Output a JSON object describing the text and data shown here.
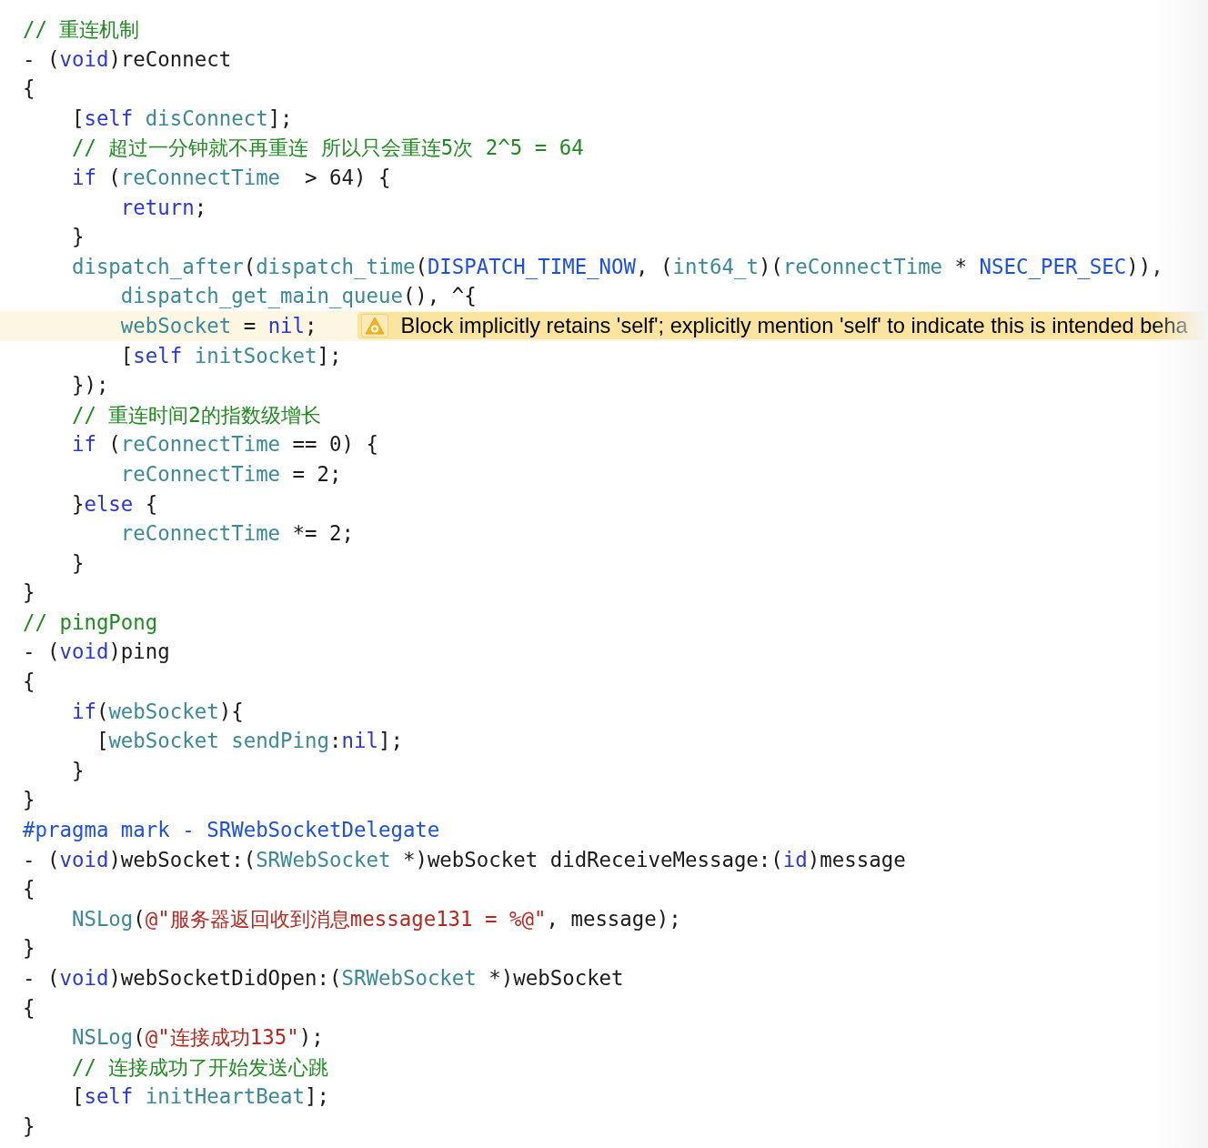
{
  "lines": [
    {
      "tokens": [
        {
          "comment": "// 重连机制"
        }
      ]
    },
    {
      "tokens": [
        {
          "plain": "- ("
        },
        {
          "keyword": "void"
        },
        {
          "plain": ")reConnect"
        }
      ]
    },
    {
      "tokens": [
        {
          "plain": "{"
        }
      ]
    },
    {
      "tokens": [
        {
          "plain": "    ["
        },
        {
          "keyword": "self"
        },
        {
          "ident": " disConnect"
        },
        {
          "plain": "];"
        }
      ]
    },
    {
      "tokens": [
        {
          "comment": "    // 超过一分钟就不再重连 所以只会重连5次 2^5 = 64"
        }
      ]
    },
    {
      "tokens": [
        {
          "keyword": "    if"
        },
        {
          "plain": " ("
        },
        {
          "ident": "reConnectTime"
        },
        {
          "plain": "  > 64) {"
        }
      ]
    },
    {
      "tokens": [
        {
          "keyword": "        return"
        },
        {
          "plain": ";"
        }
      ]
    },
    {
      "tokens": [
        {
          "plain": "    }"
        }
      ]
    },
    {
      "tokens": [
        {
          "ident": "    dispatch_after"
        },
        {
          "plain": "("
        },
        {
          "ident": "dispatch_time"
        },
        {
          "plain": "("
        },
        {
          "macro": "DISPATCH_TIME_NOW"
        },
        {
          "plain": ", ("
        },
        {
          "ident": "int64_t"
        },
        {
          "plain": ")("
        },
        {
          "ident": "reConnectTime"
        },
        {
          "plain": " * "
        },
        {
          "macro": "NSEC_PER_SEC"
        },
        {
          "plain": ")),"
        }
      ]
    },
    {
      "tokens": [
        {
          "ident": "        dispatch_get_main_queue"
        },
        {
          "plain": "(), ^{"
        }
      ]
    },
    {
      "highlighted": true,
      "issue": {
        "kind": "warning",
        "text": "Block implicitly retains 'self'; explicitly mention 'self' to indicate this is intended beha"
      },
      "tokens": [
        {
          "ident": "        webSocket"
        },
        {
          "plain": " = "
        },
        {
          "keyword": "nil"
        },
        {
          "plain": ";"
        }
      ]
    },
    {
      "tokens": [
        {
          "plain": "        ["
        },
        {
          "keyword": "self"
        },
        {
          "ident": " initSocket"
        },
        {
          "plain": "];"
        }
      ]
    },
    {
      "tokens": [
        {
          "plain": "    });"
        }
      ]
    },
    {
      "tokens": [
        {
          "comment": "    // 重连时间2的指数级增长"
        }
      ]
    },
    {
      "tokens": [
        {
          "keyword": "    if"
        },
        {
          "plain": " ("
        },
        {
          "ident": "reConnectTime"
        },
        {
          "plain": " == 0) {"
        }
      ]
    },
    {
      "tokens": [
        {
          "ident": "        reConnectTime"
        },
        {
          "plain": " = 2;"
        }
      ]
    },
    {
      "tokens": [
        {
          "plain": "    }"
        },
        {
          "keyword": "else"
        },
        {
          "plain": " {"
        }
      ]
    },
    {
      "tokens": [
        {
          "ident": "        reConnectTime"
        },
        {
          "plain": " *= 2;"
        }
      ]
    },
    {
      "tokens": [
        {
          "plain": "    }"
        }
      ]
    },
    {
      "tokens": [
        {
          "plain": "}"
        }
      ]
    },
    {
      "tokens": [
        {
          "comment": "// pingPong"
        }
      ]
    },
    {
      "tokens": [
        {
          "plain": "- ("
        },
        {
          "keyword": "void"
        },
        {
          "plain": ")ping"
        }
      ]
    },
    {
      "tokens": [
        {
          "plain": "{"
        }
      ]
    },
    {
      "tokens": [
        {
          "keyword": "    if"
        },
        {
          "plain": "("
        },
        {
          "ident": "webSocket"
        },
        {
          "plain": "){"
        }
      ]
    },
    {
      "tokens": [
        {
          "plain": "      ["
        },
        {
          "ident": "webSocket sendPing"
        },
        {
          "plain": ":"
        },
        {
          "keyword": "nil"
        },
        {
          "plain": "];"
        }
      ]
    },
    {
      "tokens": [
        {
          "plain": "    }"
        }
      ]
    },
    {
      "tokens": [
        {
          "plain": "}"
        }
      ]
    },
    {
      "tokens": [
        {
          "macro": "#pragma mark - SRWebSocketDelegate"
        }
      ]
    },
    {
      "tokens": [
        {
          "plain": "- ("
        },
        {
          "keyword": "void"
        },
        {
          "plain": ")webSocket:("
        },
        {
          "ident": "SRWebSocket"
        },
        {
          "plain": " *)webSocket didReceiveMessage:("
        },
        {
          "keyword": "id"
        },
        {
          "plain": ")message"
        }
      ]
    },
    {
      "tokens": [
        {
          "plain": "{"
        }
      ]
    },
    {
      "tokens": [
        {
          "ident": "    NSLog"
        },
        {
          "plain": "("
        },
        {
          "string": "@\"服务器返回收到消息message131 = %@\""
        },
        {
          "plain": ", message);"
        }
      ]
    },
    {
      "tokens": [
        {
          "plain": "}"
        }
      ]
    },
    {
      "tokens": [
        {
          "plain": "- ("
        },
        {
          "keyword": "void"
        },
        {
          "plain": ")webSocketDidOpen:("
        },
        {
          "ident": "SRWebSocket"
        },
        {
          "plain": " *)webSocket"
        }
      ]
    },
    {
      "tokens": [
        {
          "plain": "{"
        }
      ]
    },
    {
      "tokens": [
        {
          "ident": "    NSLog"
        },
        {
          "plain": "("
        },
        {
          "string": "@\"连接成功135\""
        },
        {
          "plain": ");"
        }
      ]
    },
    {
      "tokens": [
        {
          "comment": "    // 连接成功了开始发送心跳"
        }
      ]
    },
    {
      "tokens": [
        {
          "plain": "    ["
        },
        {
          "keyword": "self"
        },
        {
          "ident": " initHeartBeat"
        },
        {
          "plain": "];"
        }
      ]
    },
    {
      "tokens": [
        {
          "plain": "}"
        }
      ]
    }
  ]
}
